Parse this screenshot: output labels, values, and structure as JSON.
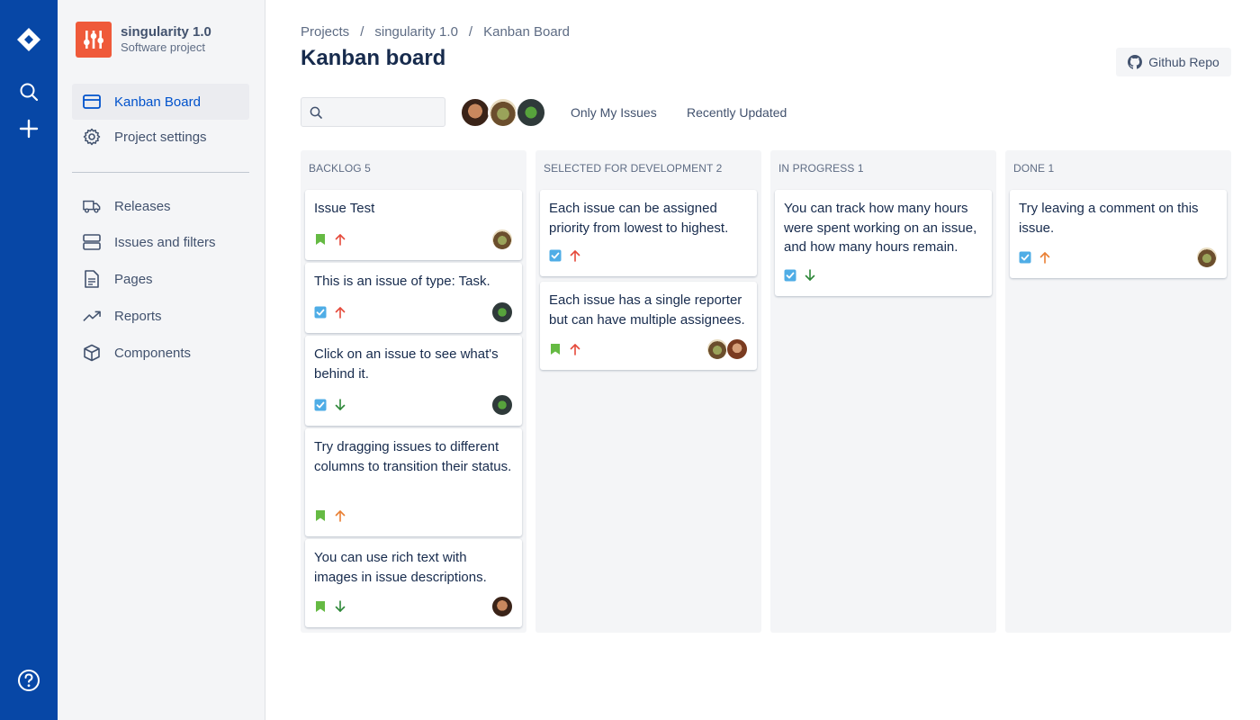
{
  "sidebar": {
    "project_name": "singularity 1.0",
    "project_type": "Software project",
    "items": [
      {
        "label": "Kanban Board",
        "icon": "board-icon"
      },
      {
        "label": "Project settings",
        "icon": "gear-icon"
      },
      {
        "label": "Releases",
        "icon": "truck-icon"
      },
      {
        "label": "Issues and filters",
        "icon": "stack-icon"
      },
      {
        "label": "Pages",
        "icon": "document-icon"
      },
      {
        "label": "Reports",
        "icon": "trend-icon"
      },
      {
        "label": "Components",
        "icon": "cube-icon"
      }
    ]
  },
  "breadcrumb": [
    "Projects",
    "singularity 1.0",
    "Kanban Board"
  ],
  "breadcrumb_sep": "/",
  "page_title": "Kanban board",
  "github_button": "Github Repo",
  "search": {
    "value": "",
    "placeholder": ""
  },
  "filters": {
    "only_mine": "Only My Issues",
    "recent": "Recently Updated"
  },
  "columns": [
    {
      "title": "Backlog 5",
      "cards": [
        {
          "text": "Issue Test",
          "type": "story",
          "priority": "high",
          "assignees": [
            "b"
          ]
        },
        {
          "text": "This is an issue of type: Task.",
          "type": "task",
          "priority": "high",
          "assignees": [
            "c"
          ]
        },
        {
          "text": "Click on an issue to see what's behind it.",
          "type": "task",
          "priority": "low",
          "assignees": [
            "c"
          ]
        },
        {
          "text": "Try dragging issues to different columns to transition their status.",
          "type": "story",
          "priority": "medium",
          "assignees": []
        },
        {
          "text": "You can use rich text with images in issue descriptions.",
          "type": "story",
          "priority": "low",
          "assignees": [
            "a"
          ]
        }
      ]
    },
    {
      "title": "Selected for development 2",
      "cards": [
        {
          "text": "Each issue can be assigned priority from lowest to highest.",
          "type": "task",
          "priority": "high",
          "assignees": []
        },
        {
          "text": "Each issue has a single reporter but can have multiple assignees.",
          "type": "story",
          "priority": "high",
          "assignees": [
            "b",
            "d"
          ]
        }
      ]
    },
    {
      "title": "In progress 1",
      "cards": [
        {
          "text": "You can track how many hours were spent working on an issue, and how many hours remain.",
          "type": "task",
          "priority": "low",
          "assignees": []
        }
      ]
    },
    {
      "title": "Done 1",
      "cards": [
        {
          "text": "Try leaving a comment on this issue.",
          "type": "task",
          "priority": "medium",
          "assignees": [
            "b"
          ]
        }
      ]
    }
  ],
  "colors": {
    "nav": "#0747a6",
    "accent": "#0052cc",
    "story": "#65ba43",
    "task": "#4fade6",
    "priority_high": "#e5493a",
    "priority_medium": "#e97f33",
    "priority_low": "#2d8738"
  }
}
